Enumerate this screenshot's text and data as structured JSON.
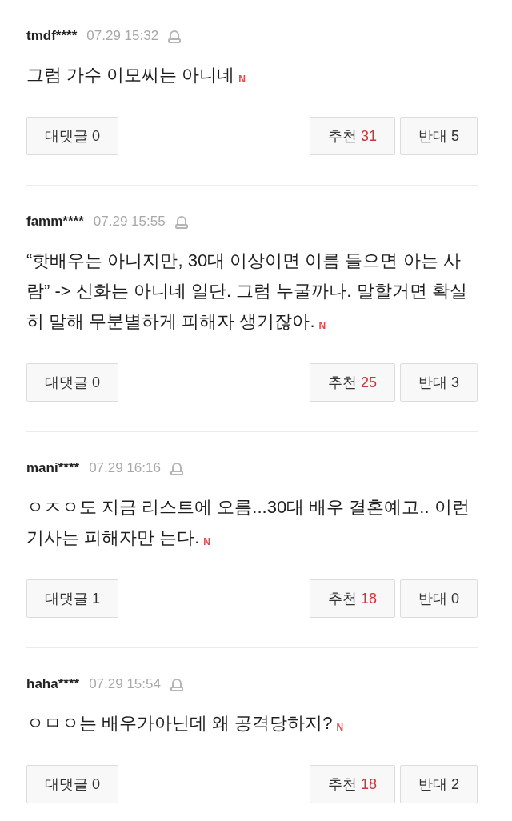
{
  "comments": [
    {
      "author": "tmdf****",
      "time": "07.29 15:32",
      "text": "그럼 가수 이모씨는 아니네",
      "new_badge": "N",
      "reply_button": "대댓글 0",
      "like_label": "추천",
      "like_count": "31",
      "dislike_button": "반대 5"
    },
    {
      "author": "famm****",
      "time": "07.29 15:55",
      "text": "“핫배우는 아니지만, 30대 이상이면 이름 들으면 아는 사람” -> 신화는 아니네 일단. 그럼 누굴까나. 말할거면 확실히 말해 무분별하게 피해자 생기잖아.",
      "new_badge": "N",
      "reply_button": "대댓글 0",
      "like_label": "추천",
      "like_count": "25",
      "dislike_button": "반대 3"
    },
    {
      "author": "mani****",
      "time": "07.29 16:16",
      "text": "ㅇㅈㅇ도 지금 리스트에 오름...30대 배우 결혼예고.. 이런기사는 피해자만 는다.",
      "new_badge": "N",
      "reply_button": "대댓글 1",
      "like_label": "추천",
      "like_count": "18",
      "dislike_button": "반대 0"
    },
    {
      "author": "haha****",
      "time": "07.29 15:54",
      "text": "ㅇㅁㅇ는 배우가아닌데 왜 공격당하지?",
      "new_badge": "N",
      "reply_button": "대댓글 0",
      "like_label": "추천",
      "like_count": "18",
      "dislike_button": "반대 2"
    }
  ]
}
